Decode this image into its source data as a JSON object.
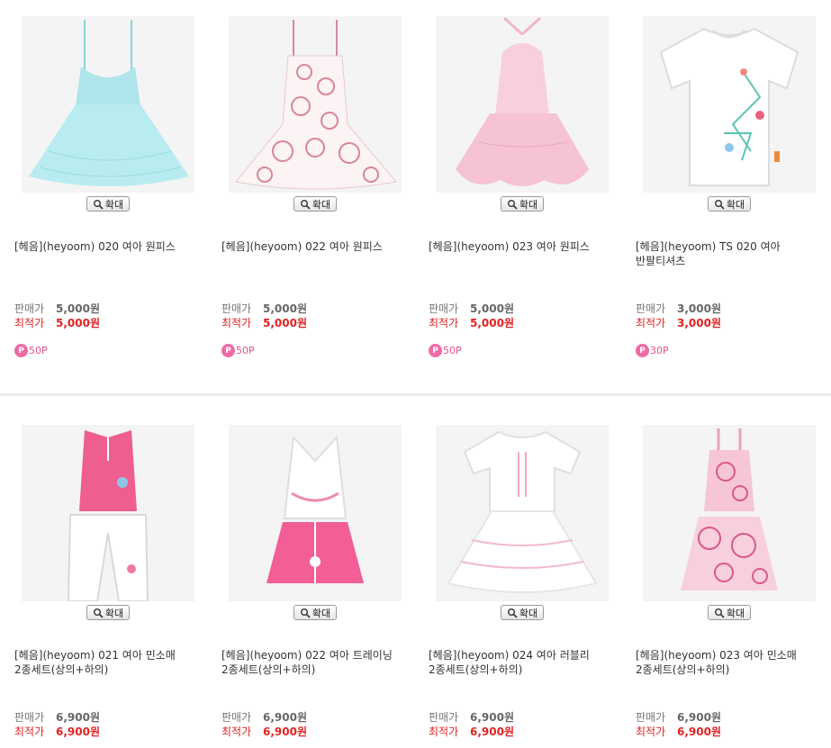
{
  "zoom_label": "확대",
  "labels": {
    "sale": "판매가",
    "best": "최적가"
  },
  "row1": [
    {
      "name": "[헤음](heyoom) 020 여아 원피스",
      "sale": "5,000원",
      "best": "5,000원",
      "point": "50P"
    },
    {
      "name": "[헤음](heyoom) 022 여아 원피스",
      "sale": "5,000원",
      "best": "5,000원",
      "point": "50P"
    },
    {
      "name": "[헤음](heyoom) 023 여아 원피스",
      "sale": "5,000원",
      "best": "5,000원",
      "point": "50P"
    },
    {
      "name": "[헤음](heyoom) TS 020 여아 반팔티셔츠",
      "sale": "3,000원",
      "best": "3,000원",
      "point": "30P"
    }
  ],
  "row2": [
    {
      "name": "[헤음](heyoom) 021 여아 민소매 2종세트(상의+하의)",
      "sale": "6,900원",
      "best": "6,900원"
    },
    {
      "name": "[헤음](heyoom) 022 여아 트레이닝 2종세트(상의+하의)",
      "sale": "6,900원",
      "best": "6,900원"
    },
    {
      "name": "[헤음](heyoom) 024 여아 러블리 2종세트(상의+하의)",
      "sale": "6,900원",
      "best": "6,900원"
    },
    {
      "name": "[헤음](heyoom) 023 여아 민소매 2종세트(상의+하의)",
      "sale": "6,900원",
      "best": "6,900원"
    }
  ]
}
